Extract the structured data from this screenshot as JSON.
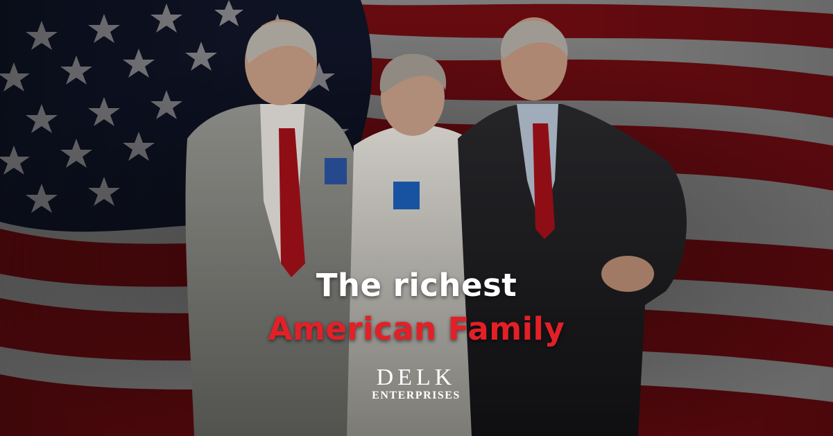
{
  "headline": {
    "line1": "The richest",
    "line2": "American Family",
    "line2_color": "#e32027"
  },
  "logo": {
    "word1": "DELK",
    "word2": "ENTERPRISES"
  },
  "colors": {
    "flag_red": "#b3141d",
    "flag_white": "#e8e8e8",
    "flag_blue": "#1a2240"
  },
  "scene": {
    "background": "waving-american-flag",
    "people": [
      "man-in-grey-suit",
      "woman-in-white-blouse",
      "man-in-dark-suit"
    ]
  }
}
